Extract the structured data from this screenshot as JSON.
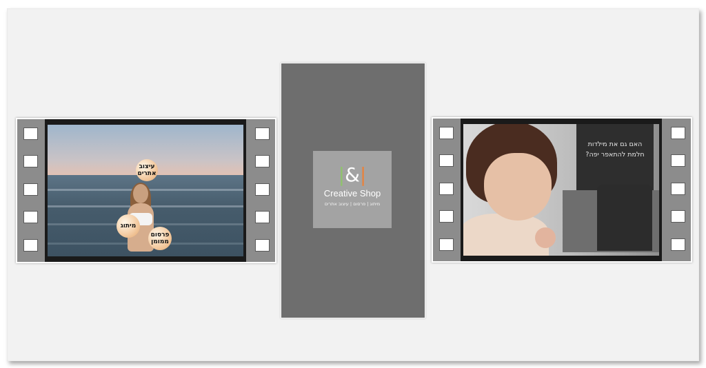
{
  "left_video": {
    "bubbles": [
      {
        "text": "עיצוב אתרים"
      },
      {
        "text": "מיתוג"
      },
      {
        "text": "פרסום ממומן"
      }
    ]
  },
  "center_card": {
    "logo_mark": "I&I",
    "brand_name": "Creative Shop",
    "tagline": "מיתוג | פרסום | עיצוב אתרים",
    "colors": {
      "background": "#6e6e6e",
      "logo_box": "#a3a3a3",
      "accent_green": "#8fc46b",
      "accent_orange": "#e8823c"
    }
  },
  "right_video": {
    "caption_line1": "האם גם את מילדות",
    "caption_line2": "חלמת להתאפר יפה?"
  }
}
